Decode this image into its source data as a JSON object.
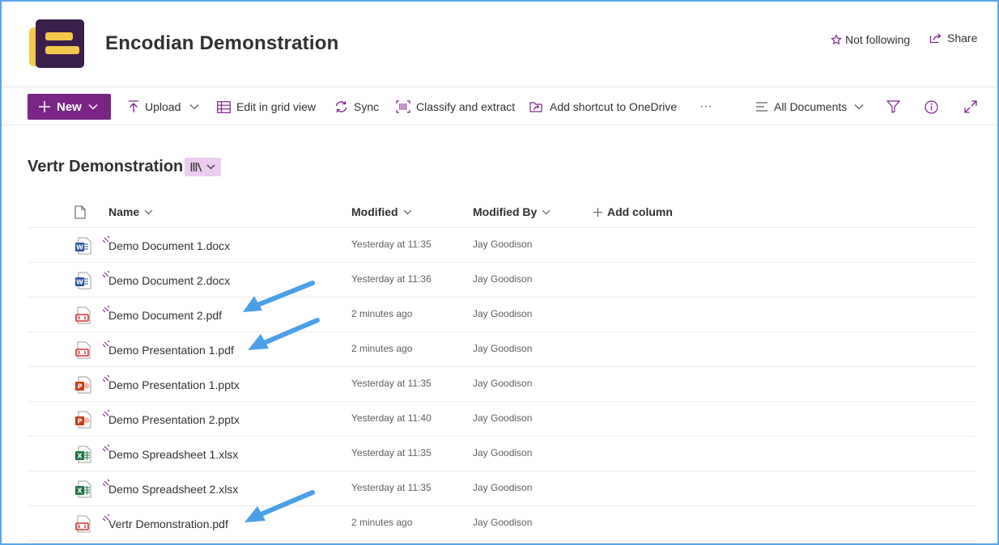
{
  "site": {
    "title": "Encodian Demonstration",
    "follow_label": "Not following",
    "share_label": "Share"
  },
  "commandbar": {
    "new_label": "New",
    "upload_label": "Upload",
    "grid_label": "Edit in grid view",
    "sync_label": "Sync",
    "classify_label": "Classify and extract",
    "shortcut_label": "Add shortcut to OneDrive",
    "more_label": "···",
    "view_label": "All Documents"
  },
  "library": {
    "title": "Vertr Demonstration"
  },
  "columns": {
    "name": "Name",
    "modified": "Modified",
    "modified_by": "Modified By",
    "add_column": "Add column"
  },
  "files": [
    {
      "name": "Demo Document 1.docx",
      "modified": "Yesterday at 11:35",
      "modified_by": "Jay Goodison",
      "type": "word"
    },
    {
      "name": "Demo Document 2.docx",
      "modified": "Yesterday at 11:36",
      "modified_by": "Jay Goodison",
      "type": "word"
    },
    {
      "name": "Demo Document 2.pdf",
      "modified": "2 minutes ago",
      "modified_by": "Jay Goodison",
      "type": "pdf"
    },
    {
      "name": "Demo Presentation 1.pdf",
      "modified": "2 minutes ago",
      "modified_by": "Jay Goodison",
      "type": "pdf"
    },
    {
      "name": "Demo Presentation 1.pptx",
      "modified": "Yesterday at 11:35",
      "modified_by": "Jay Goodison",
      "type": "powerpoint"
    },
    {
      "name": "Demo Presentation 2.pptx",
      "modified": "Yesterday at 11:40",
      "modified_by": "Jay Goodison",
      "type": "powerpoint"
    },
    {
      "name": "Demo Spreadsheet 1.xlsx",
      "modified": "Yesterday at 11:35",
      "modified_by": "Jay Goodison",
      "type": "excel"
    },
    {
      "name": "Demo Spreadsheet 2.xlsx",
      "modified": "Yesterday at 11:35",
      "modified_by": "Jay Goodison",
      "type": "excel"
    },
    {
      "name": "Vertr Demonstration.pdf",
      "modified": "2 minutes ago",
      "modified_by": "Jay Goodison",
      "type": "pdf"
    }
  ],
  "icons": {
    "word": "word-file-icon",
    "pdf": "pdf-file-icon",
    "powerpoint": "powerpoint-file-icon",
    "excel": "excel-file-icon"
  },
  "colors": {
    "accent": "#7a2586",
    "accent_light": "#eccdf0",
    "annotation_arrow": "#4b9fe8",
    "word": "#2b579a",
    "pdf": "#d13438",
    "powerpoint": "#c43e1c",
    "excel": "#217346"
  }
}
